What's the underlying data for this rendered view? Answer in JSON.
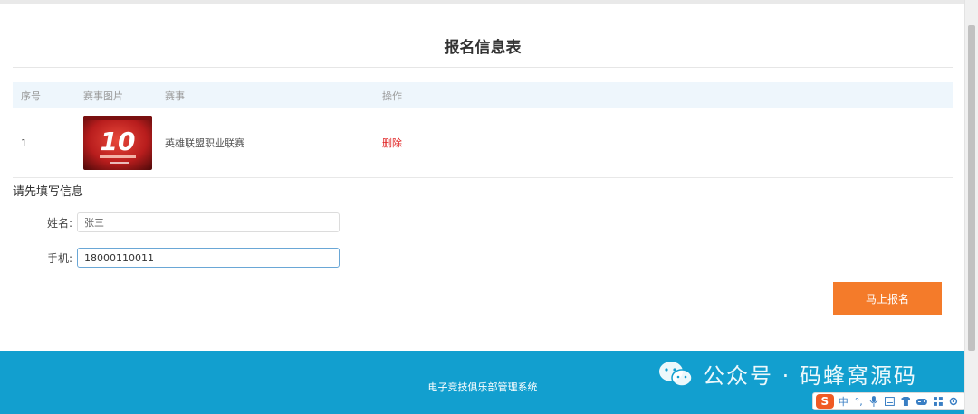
{
  "page": {
    "title": "报名信息表"
  },
  "table": {
    "headers": {
      "index": "序号",
      "image": "赛事图片",
      "event": "赛事",
      "action": "操作"
    },
    "rows": [
      {
        "index": "1",
        "event": "英雄联盟职业联赛",
        "action": "删除"
      }
    ]
  },
  "form": {
    "title": "请先填写信息",
    "name_label": "姓名:",
    "name_value": "张三",
    "phone_label": "手机:",
    "phone_value": "18000110011",
    "submit_label": "马上报名"
  },
  "footer": {
    "text": "电子竞技俱乐部管理系统"
  },
  "watermark": {
    "text": "公众号 · 码蜂窝源码"
  },
  "ime": {
    "logo": "S",
    "mode": "中",
    "punct": "°,",
    "items": [
      "mic-icon",
      "keyboard-icon",
      "shirt-icon",
      "gamepad-icon",
      "grid-icon",
      "settings-icon"
    ]
  },
  "colors": {
    "accent": "#f47b2a",
    "footer": "#129fcf",
    "delete": "#e02020",
    "header_bg": "#eef6fc"
  }
}
